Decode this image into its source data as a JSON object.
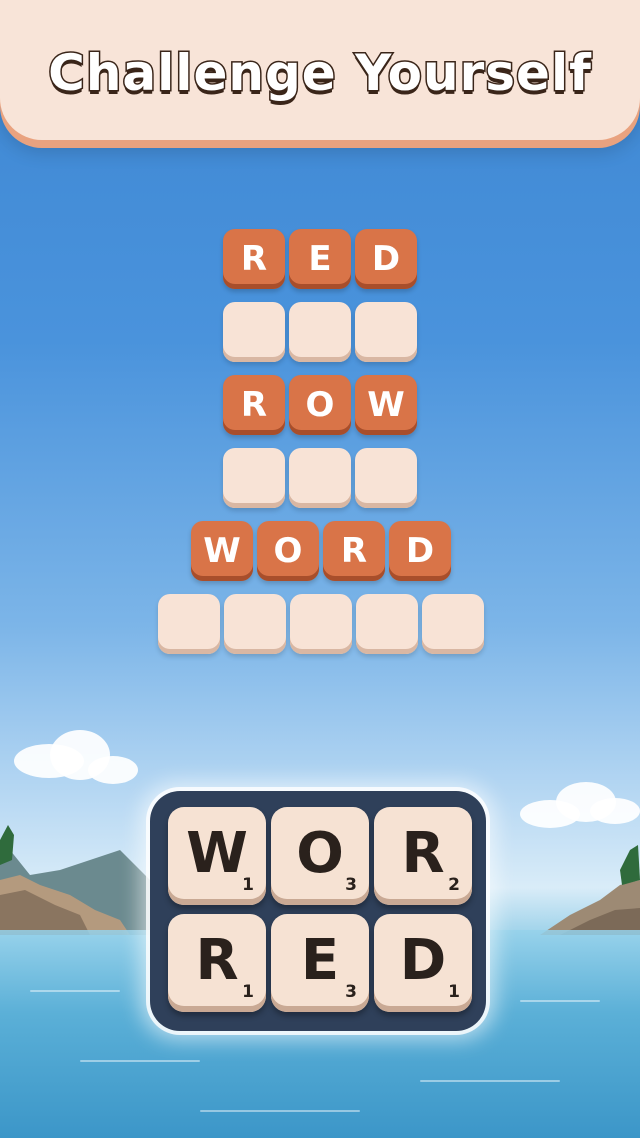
{
  "banner": {
    "title": "Challenge Yourself"
  },
  "puzzle": {
    "rows": [
      {
        "state": "filled",
        "letters": [
          "R",
          "E",
          "D"
        ]
      },
      {
        "state": "empty",
        "letters": [
          "",
          "",
          ""
        ]
      },
      {
        "state": "filled",
        "letters": [
          "R",
          "O",
          "W"
        ]
      },
      {
        "state": "empty",
        "letters": [
          "",
          "",
          ""
        ]
      },
      {
        "state": "filled",
        "letters": [
          "W",
          "O",
          "R",
          "D"
        ]
      },
      {
        "state": "empty",
        "letters": [
          "",
          "",
          "",
          "",
          ""
        ]
      }
    ]
  },
  "letter_board": {
    "tiles": [
      {
        "letter": "W",
        "points": "1"
      },
      {
        "letter": "O",
        "points": "3"
      },
      {
        "letter": "R",
        "points": "2"
      },
      {
        "letter": "R",
        "points": "1"
      },
      {
        "letter": "E",
        "points": "3"
      },
      {
        "letter": "D",
        "points": "1"
      }
    ]
  },
  "colors": {
    "filled_tile": "#d97448",
    "empty_tile": "#f8e3d6",
    "board_background": "#2f405a",
    "banner_background": "#f8e4d8"
  }
}
